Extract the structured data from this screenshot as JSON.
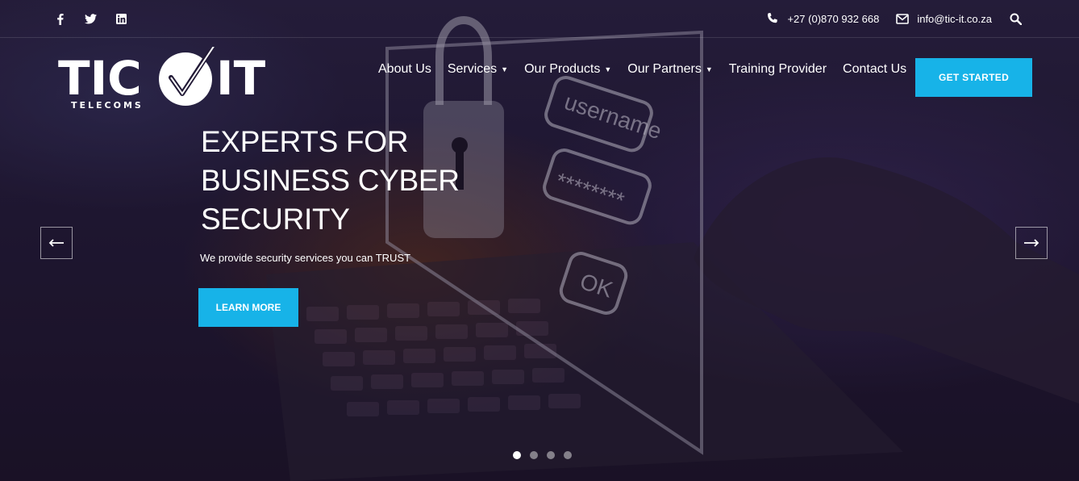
{
  "topbar": {
    "social": [
      {
        "icon": "facebook-icon",
        "glyph": "f"
      },
      {
        "icon": "twitter-icon",
        "glyph": "t"
      },
      {
        "icon": "linkedin-icon",
        "glyph": "in"
      }
    ],
    "phone": "+27 (0)870 932 668",
    "email": "info@tic-it.co.za"
  },
  "logo": {
    "main_left": "TIC",
    "main_right": "IT",
    "sub": "TELECOMS"
  },
  "nav": {
    "items": [
      {
        "label": "About Us",
        "dropdown": false
      },
      {
        "label": "Services",
        "dropdown": true
      },
      {
        "label": "Our Products",
        "dropdown": true
      },
      {
        "label": "Our Partners",
        "dropdown": true
      },
      {
        "label": "Training Provider",
        "dropdown": false
      },
      {
        "label": "Contact Us",
        "dropdown": false
      }
    ],
    "cta_label": "GET STARTED"
  },
  "hero": {
    "headline_lines": [
      "EXPERTS FOR",
      "BUSINESS CYBER",
      "SECURITY"
    ],
    "tagline": "We provide security services you can TRUST",
    "button_label": "LEARN MORE",
    "screen_texts": {
      "username": "username",
      "password": "********",
      "ok": "OK"
    },
    "slides": 4,
    "active_slide": 1
  },
  "colors": {
    "accent": "#17b3e8",
    "background": "#221a36"
  }
}
